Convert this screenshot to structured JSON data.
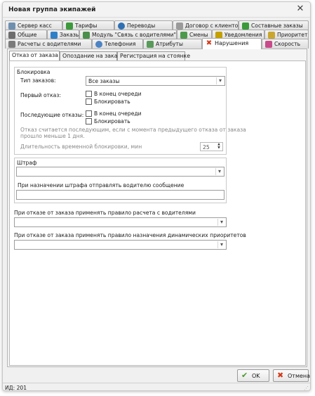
{
  "window": {
    "title": "Новая группа экипажей"
  },
  "tabs_row1": [
    {
      "label": "Сервер касс",
      "icon": "cash-server-icon",
      "color": "#6f8fb0"
    },
    {
      "label": "Тарифы",
      "icon": "tariffs-icon",
      "color": "#3c9a3c"
    },
    {
      "label": "Переводы",
      "icon": "transfers-icon",
      "color": "#2f6fb4"
    },
    {
      "label": "Договор с клиентом",
      "icon": "contract-icon",
      "color": "#9a9a9a"
    },
    {
      "label": "Составные заказы",
      "icon": "compound-orders-icon",
      "color": "#3a9a3a"
    }
  ],
  "tabs_row2": [
    {
      "label": "Общие",
      "icon": "general-icon",
      "color": "#6d6d6d"
    },
    {
      "label": "Заказы",
      "icon": "orders-icon",
      "color": "#2f7fc8"
    },
    {
      "label": "Модуль \"Связь с водителями\"",
      "icon": "drivers-link-icon",
      "color": "#4a8f4a"
    },
    {
      "label": "Смены",
      "icon": "shifts-icon",
      "color": "#4d9a4d"
    },
    {
      "label": "Уведомления",
      "icon": "notifications-icon",
      "color": "#c4a000"
    },
    {
      "label": "Приоритеты",
      "icon": "priorities-icon",
      "color": "#c9a630"
    }
  ],
  "tabs_row3": [
    {
      "label": "Расчеты с водителями",
      "icon": "driver-payments-icon",
      "color": "#7b7b7b"
    },
    {
      "label": "Телефония",
      "icon": "telephony-icon",
      "color": "#4c84c4"
    },
    {
      "label": "Атрибуты",
      "icon": "attributes-icon",
      "color": "#5a9a5a"
    },
    {
      "label": "Нарушения",
      "icon": "violations-icon",
      "color": "#d23a1a",
      "glyph": "✖"
    },
    {
      "label": "Скорость",
      "icon": "speed-icon",
      "color": "#c94a8a"
    }
  ],
  "subtabs": [
    {
      "label": "Отказ от заказа"
    },
    {
      "label": "Опоздание на заказ"
    },
    {
      "label": "Регистрация на стоянке"
    }
  ],
  "block": {
    "title": "Блокировка",
    "order_type_label": "Тип заказов:",
    "order_type_value": "Все заказы",
    "first_refusal_label": "Первый отказ:",
    "first_end_of_queue": "В конец очереди",
    "first_block": "Блокировать",
    "subsequent_label": "Последующие отказы:",
    "subsequent_end_of_queue": "В конец очереди",
    "subsequent_block": "Блокировать",
    "note_line1": "Отказ считается последующим, если с момента предыдущего отказа от заказа",
    "note_line2": "прошло меньше 1 дня.",
    "duration_label": "Длительность временной блокировки, мин",
    "duration_value": "25"
  },
  "fine": {
    "title": "Штраф",
    "message_label": "При назначении штрафа отправлять водителю сообщение"
  },
  "rules": {
    "calc_label": "При отказе от заказа применять правило расчета с водителями",
    "priority_label": "При отказе от заказа применять правило назначения динамических приоритетов"
  },
  "footer": {
    "ok_label": "OK",
    "cancel_label": "Отмена",
    "status": "ИД: 201"
  }
}
